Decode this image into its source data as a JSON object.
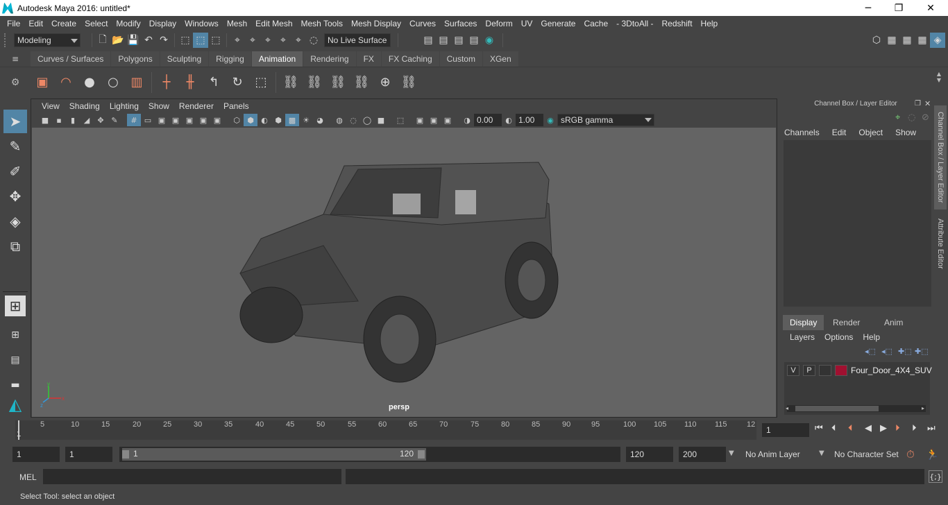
{
  "window": {
    "title": "Autodesk Maya 2016: untitled*",
    "minimize": "─",
    "maximize": "❐",
    "close": "✕"
  },
  "menus": [
    "File",
    "Edit",
    "Create",
    "Select",
    "Modify",
    "Display",
    "Windows",
    "Mesh",
    "Edit Mesh",
    "Mesh Tools",
    "Mesh Display",
    "Curves",
    "Surfaces",
    "Deform",
    "UV",
    "Generate",
    "Cache",
    "- 3DtoAll -",
    "Redshift",
    "Help"
  ],
  "statusline": {
    "menuset": "Modeling",
    "live_surface": "No Live Surface"
  },
  "shelf_tabs": [
    "Curves / Surfaces",
    "Polygons",
    "Sculpting",
    "Rigging",
    "Animation",
    "Rendering",
    "FX",
    "FX Caching",
    "Custom",
    "XGen"
  ],
  "active_shelf_tab": "Animation",
  "panel_menu": [
    "View",
    "Shading",
    "Lighting",
    "Show",
    "Renderer",
    "Panels"
  ],
  "panel_tools": {
    "exposure": "0.00",
    "gamma": "1.00",
    "color_space": "sRGB gamma"
  },
  "viewport": {
    "camera_label": "persp",
    "axis_x": "x",
    "axis_y": "y",
    "axis_z": "z"
  },
  "channel_box": {
    "title": "Channel Box / Layer Editor",
    "menu": [
      "Channels",
      "Edit",
      "Object",
      "Show"
    ]
  },
  "side_tabs": {
    "channel_box": "Channel Box / Layer Editor",
    "attribute_editor": "Attribute Editor"
  },
  "layer_editor": {
    "tabs": [
      "Display",
      "Render",
      "Anim"
    ],
    "active_tab": "Display",
    "menu": [
      "Layers",
      "Options",
      "Help"
    ],
    "layers": [
      {
        "visible": "V",
        "playback": "P",
        "name": "Four_Door_4X4_SUV",
        "color": "#a01030"
      }
    ]
  },
  "timeline": {
    "ticks": [
      "5",
      "10",
      "15",
      "20",
      "25",
      "30",
      "35",
      "40",
      "45",
      "50",
      "55",
      "60",
      "65",
      "70",
      "75",
      "80",
      "85",
      "90",
      "95",
      "100",
      "105",
      "110",
      "115",
      "12"
    ],
    "first_tick": "1",
    "current_frame": "1"
  },
  "range": {
    "start": "1",
    "anim_start": "1",
    "slider_start": "1",
    "slider_end": "120",
    "end": "120",
    "anim_end": "200",
    "anim_layer": "No Anim Layer",
    "character_set": "No Character Set"
  },
  "command_line": {
    "label": "MEL"
  },
  "help_line": {
    "text": "Select Tool: select an object"
  }
}
